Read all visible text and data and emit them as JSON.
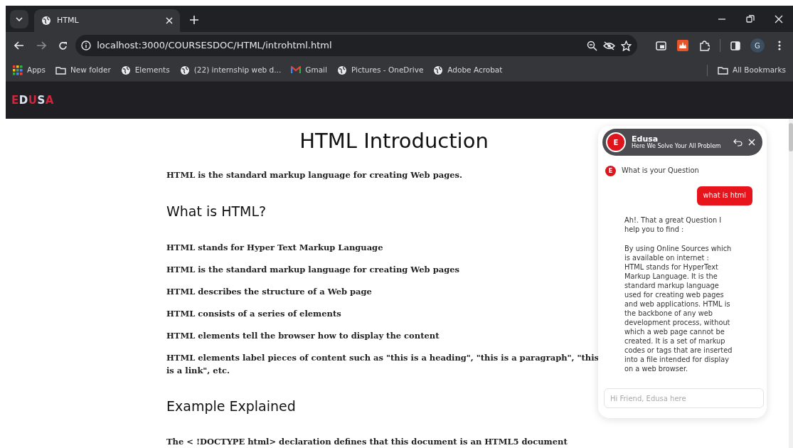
{
  "browser": {
    "tabs": [
      {
        "title": "HTML",
        "selected": true
      }
    ],
    "address": "localhost:3000/COURSESDOC/HTML/introhtml.html",
    "profile_initial": "G",
    "bookmarks": [
      {
        "label": "Apps",
        "kind": "apps"
      },
      {
        "label": "New folder",
        "kind": "folder"
      },
      {
        "label": "Elements",
        "kind": "globe"
      },
      {
        "label": "(22) internship web d...",
        "kind": "globe"
      },
      {
        "label": "Gmail",
        "kind": "mail"
      },
      {
        "label": "Pictures - OneDrive",
        "kind": "globe"
      },
      {
        "label": "Adobe Acrobat",
        "kind": "globe"
      }
    ],
    "all_bookmarks": "All Bookmarks"
  },
  "navbar": {
    "logo": [
      {
        "text": "E",
        "color": "#d0243a"
      },
      {
        "text": "D",
        "color": "#dde3ee"
      },
      {
        "text": "U",
        "color": "#d0243a"
      },
      {
        "text": "S",
        "color": "#dde3ee"
      },
      {
        "text": "A",
        "color": "#d0243a"
      }
    ]
  },
  "article": {
    "title": "HTML Introduction",
    "blocks": [
      {
        "kind": "p",
        "text": "HTML is the standard markup language for creating Web pages."
      },
      {
        "kind": "h2",
        "text": "What is HTML?"
      },
      {
        "kind": "item",
        "text": "HTML stands for Hyper Text Markup Language"
      },
      {
        "kind": "item",
        "text": "HTML is the standard markup language for creating Web pages"
      },
      {
        "kind": "item",
        "text": "HTML describes the structure of a Web page"
      },
      {
        "kind": "item",
        "text": "HTML consists of a series of elements"
      },
      {
        "kind": "item",
        "text": "HTML elements tell the browser how to display the content"
      },
      {
        "kind": "item",
        "text": "HTML elements label pieces of content such as \"this is a heading\", \"this is a paragraph\", \"this is a link\", etc."
      },
      {
        "kind": "h2",
        "text": "Example Explained"
      },
      {
        "kind": "p",
        "text": "The < !DOCTYPE html> declaration defines that this document is an HTML5 document"
      }
    ]
  },
  "chat": {
    "name": "Edusa",
    "tagline": "Here We Solve Your All Problem",
    "avatar": "E",
    "messages": [
      {
        "kind": "bot",
        "avatar": "E",
        "text": "What is your Question"
      },
      {
        "kind": "user",
        "text": "what is html"
      },
      {
        "kind": "bot",
        "text": "Ah!. That a great Question I help you to find :"
      },
      {
        "kind": "bot",
        "text": "By using Online Sources which is available on internet :\nHTML stands for HyperText Markup Language. It is the standard markup language used for creating web pages and web applications. HTML is the backbone of any web development process, without which a web page cannot be created. It is a set of markup codes or tags that are inserted into a file intended for display on a web browser."
      }
    ],
    "input": {
      "placeholder": "Hi Friend, Edusa here"
    }
  }
}
